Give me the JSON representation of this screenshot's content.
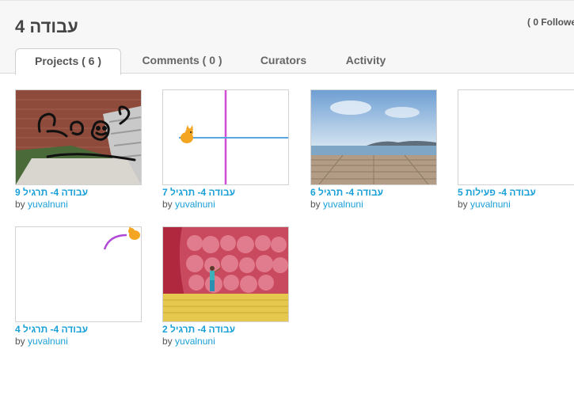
{
  "header": {
    "studio_title": "עבודה 4",
    "followers": "( 0 Followe"
  },
  "tabs": [
    {
      "label": "Projects ( 6 )",
      "active": true
    },
    {
      "label": "Comments ( 0 )",
      "active": false
    },
    {
      "label": "Curators",
      "active": false
    },
    {
      "label": "Activity",
      "active": false
    }
  ],
  "projects": [
    {
      "title": "עבודה 4- תרגיל 9",
      "by_label": "by",
      "author": "yuvalnuni"
    },
    {
      "title": "עבודה 4- תרגיל 7",
      "by_label": "by",
      "author": "yuvalnuni"
    },
    {
      "title": "עבודה 4- תרגיל 6",
      "by_label": "by",
      "author": "yuvalnuni"
    },
    {
      "title": "עבודה 4- פעילות 5",
      "by_label": "by",
      "author": "yuvalnuni"
    },
    {
      "title": "עבודה 4- תרגיל 4",
      "by_label": "by",
      "author": "yuvalnuni"
    },
    {
      "title": "עבודה 4- תרגיל 2",
      "by_label": "by",
      "author": "yuvalnuni"
    }
  ],
  "colors": {
    "link": "#1aa0d8",
    "header_bg": "#f7f7f7"
  }
}
